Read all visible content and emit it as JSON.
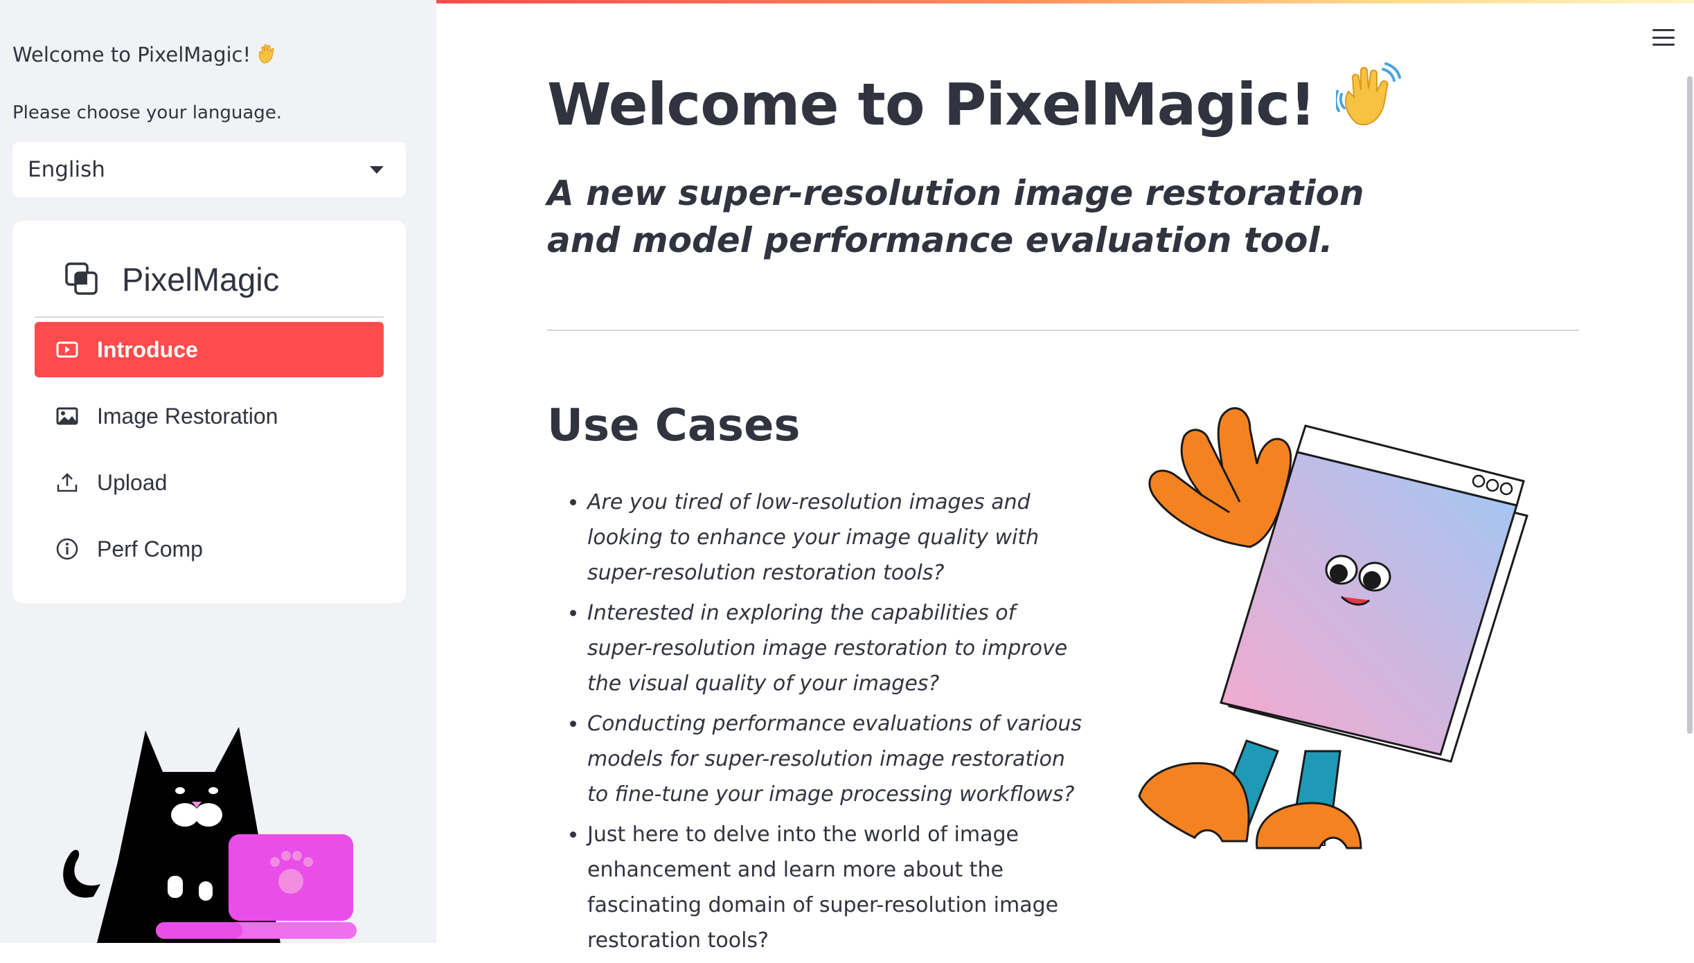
{
  "sidebar": {
    "welcome": "Welcome to PixelMagic!",
    "choose_language": "Please choose your language.",
    "language": {
      "selected": "English"
    },
    "menu": {
      "title": "PixelMagic",
      "items": [
        {
          "label": "Introduce",
          "icon": "play-icon",
          "active": true
        },
        {
          "label": "Image Restoration",
          "icon": "image-icon",
          "active": false
        },
        {
          "label": "Upload",
          "icon": "upload-icon",
          "active": false
        },
        {
          "label": "Perf Comp",
          "icon": "info-icon",
          "active": false
        }
      ]
    }
  },
  "main": {
    "title": "Welcome to PixelMagic!",
    "subtitle": "A new super-resolution image restoration and model performance evaluation tool.",
    "section_title": "Use Cases",
    "use_cases": [
      "Are you tired of low-resolution images and looking to enhance your image quality with super-resolution restoration tools?",
      "Interested in exploring the capabilities of super-resolution image restoration to improve the visual quality of your images?",
      "Conducting performance evaluations of various models for super-resolution image restoration to fine-tune your image processing workflows?",
      "Just here to delve into the world of image enhancement and learn more about the fascinating domain of super-resolution image restoration tools?"
    ]
  },
  "colors": {
    "accent": "#ff4b4b",
    "sidebar_bg": "#f0f2f6",
    "text": "#31333f"
  }
}
